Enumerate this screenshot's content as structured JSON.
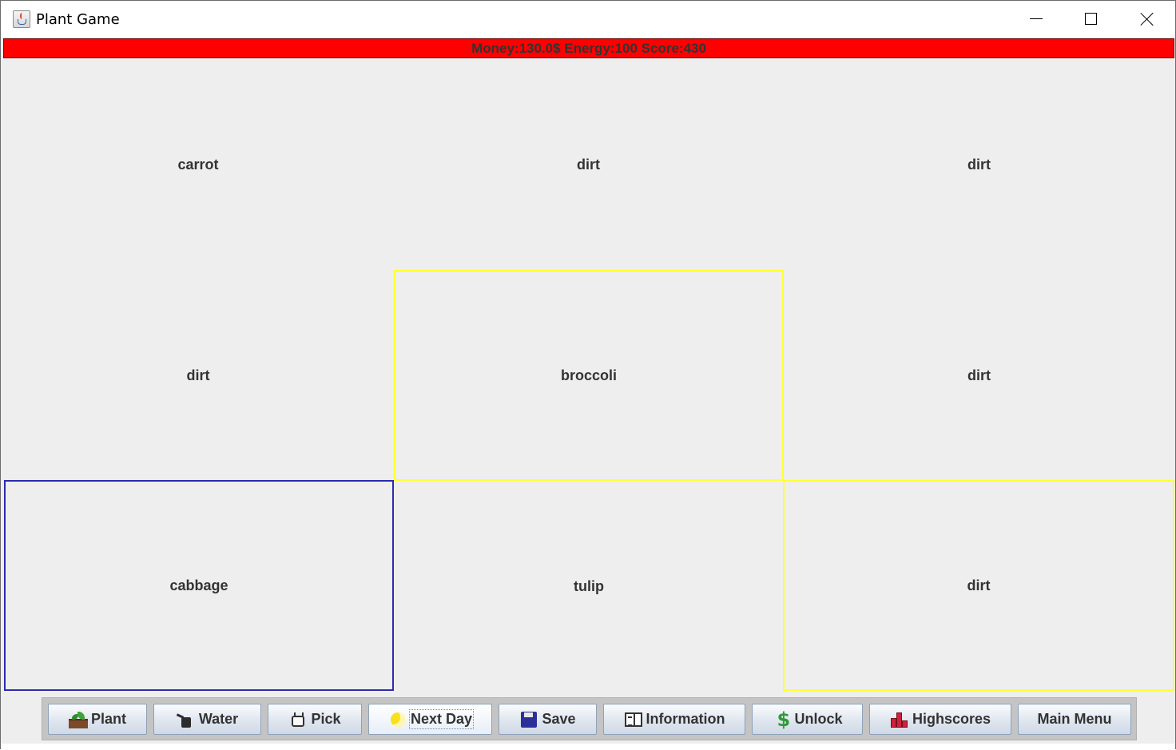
{
  "window": {
    "title": "Plant Game",
    "controls": {
      "minimize": "minimize-icon",
      "maximize": "maximize-icon",
      "close": "close-icon"
    }
  },
  "status": {
    "text": "Money:130.0$ Energy:100 Score:430",
    "background": "#ff0000"
  },
  "grid": {
    "tiles": [
      {
        "label": "carrot",
        "selection": "none"
      },
      {
        "label": "dirt",
        "selection": "none"
      },
      {
        "label": "dirt",
        "selection": "none"
      },
      {
        "label": "dirt",
        "selection": "none"
      },
      {
        "label": "broccoli",
        "selection": "yellow"
      },
      {
        "label": "dirt",
        "selection": "none"
      },
      {
        "label": "cabbage",
        "selection": "blue"
      },
      {
        "label": "tulip",
        "selection": "none"
      },
      {
        "label": "dirt",
        "selection": "yellow"
      }
    ],
    "highlight_colors": {
      "yellow": "#ffff33",
      "blue": "#2b2bb0"
    }
  },
  "toolbar": {
    "buttons": [
      {
        "label": "Plant",
        "icon": "plant-icon"
      },
      {
        "label": "Water",
        "icon": "watering-can-icon"
      },
      {
        "label": "Pick",
        "icon": "hand-icon"
      },
      {
        "label": "Next Day",
        "icon": "moon-icon"
      },
      {
        "label": "Save",
        "icon": "floppy-disk-icon"
      },
      {
        "label": "Information",
        "icon": "book-icon"
      },
      {
        "label": "Unlock",
        "icon": "dollar-icon"
      },
      {
        "label": "Highscores",
        "icon": "bar-chart-icon"
      },
      {
        "label": "Main Menu",
        "icon": ""
      }
    ]
  }
}
